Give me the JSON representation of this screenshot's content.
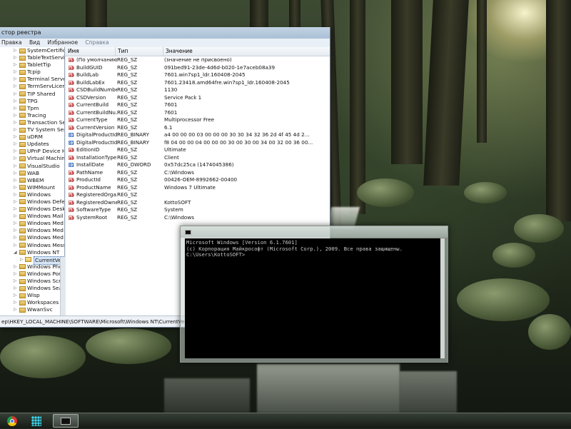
{
  "regedit": {
    "title": "стор реестра",
    "menu": [
      "Правка",
      "Вид",
      "Избранное",
      "Справка"
    ],
    "tree": [
      {
        "label": "SystemCertific",
        "exp": "▷"
      },
      {
        "label": "TableTextServi",
        "exp": "▷"
      },
      {
        "label": "TabletTip",
        "exp": "▷"
      },
      {
        "label": "Tcpip",
        "exp": "▷"
      },
      {
        "label": "Terminal Serve",
        "exp": "▷"
      },
      {
        "label": "TermServLicer",
        "exp": "▷"
      },
      {
        "label": "TIP Shared",
        "exp": "▷"
      },
      {
        "label": "TPG",
        "exp": "▷"
      },
      {
        "label": "Tpm",
        "exp": "▷"
      },
      {
        "label": "Tracing",
        "exp": "▷"
      },
      {
        "label": "Transaction Se",
        "exp": "▷"
      },
      {
        "label": "TV System Ser",
        "exp": "▷"
      },
      {
        "label": "uDRM",
        "exp": "▷"
      },
      {
        "label": "Updates",
        "exp": "▷"
      },
      {
        "label": "UPnP Device H",
        "exp": "▷"
      },
      {
        "label": "Virtual Machin",
        "exp": "▷"
      },
      {
        "label": "VisualStudio",
        "exp": "▷"
      },
      {
        "label": "WAB",
        "exp": "▷"
      },
      {
        "label": "WBEM",
        "exp": "▷"
      },
      {
        "label": "WIMMount",
        "exp": "▷"
      },
      {
        "label": "Windows",
        "exp": "▷"
      },
      {
        "label": "Windows Defe",
        "exp": "▷"
      },
      {
        "label": "Windows Desk",
        "exp": "▷"
      },
      {
        "label": "Windows Mail",
        "exp": "▷"
      },
      {
        "label": "Windows Med",
        "exp": "▷"
      },
      {
        "label": "Windows Med",
        "exp": "▷"
      },
      {
        "label": "Windows Med",
        "exp": "▷"
      },
      {
        "label": "Windows Mess",
        "exp": "▷"
      },
      {
        "label": "Windows NT",
        "exp": "◢"
      },
      {
        "label": "CurrentVer",
        "exp": "▷",
        "child": true,
        "selected": true
      },
      {
        "label": "Windows Phot",
        "exp": "▷"
      },
      {
        "label": "Windows Porta",
        "exp": "▷"
      },
      {
        "label": "Windows Scrip",
        "exp": "▷"
      },
      {
        "label": "Windows Sear",
        "exp": "▷"
      },
      {
        "label": "Wisp",
        "exp": "▷"
      },
      {
        "label": "Workspaces",
        "exp": "▷"
      },
      {
        "label": "WwanSvc",
        "exp": "▷"
      }
    ],
    "columns": [
      "Имя",
      "Тип",
      "Значение"
    ],
    "values": [
      {
        "icon": "ab",
        "name": "(По умолчанию)",
        "type": "REG_SZ",
        "data": "(значение не присвоено)"
      },
      {
        "icon": "ab",
        "name": "BuildGUID",
        "type": "REG_SZ",
        "data": "091bed91-23de-4d6d-b020-1e7aceb08a39"
      },
      {
        "icon": "ab",
        "name": "BuildLab",
        "type": "REG_SZ",
        "data": "7601.win7sp1_ldr.160408-2045"
      },
      {
        "icon": "ab",
        "name": "BuildLabEx",
        "type": "REG_SZ",
        "data": "7601.23418.amd64fre.win7sp1_ldr.160408-2045"
      },
      {
        "icon": "ab",
        "name": "CSDBuildNumber",
        "type": "REG_SZ",
        "data": "1130"
      },
      {
        "icon": "ab",
        "name": "CSDVersion",
        "type": "REG_SZ",
        "data": "Service Pack 1"
      },
      {
        "icon": "ab",
        "name": "CurrentBuild",
        "type": "REG_SZ",
        "data": "7601"
      },
      {
        "icon": "ab",
        "name": "CurrentBuildNu...",
        "type": "REG_SZ",
        "data": "7601"
      },
      {
        "icon": "ab",
        "name": "CurrentType",
        "type": "REG_SZ",
        "data": "Multiprocessor Free"
      },
      {
        "icon": "ab",
        "name": "CurrentVersion",
        "type": "REG_SZ",
        "data": "6.1"
      },
      {
        "icon": "bin",
        "name": "DigitalProductId",
        "type": "REG_BINARY",
        "data": "a4 00 00 00 03 00 00 00 30 30 34 32 36 2d 4f 45 4d 2..."
      },
      {
        "icon": "bin",
        "name": "DigitalProductId4",
        "type": "REG_BINARY",
        "data": "f8 04 00 00 04 00 00 00 30 00 30 00 34 00 32 00 36 00..."
      },
      {
        "icon": "ab",
        "name": "EditionID",
        "type": "REG_SZ",
        "data": "Ultimate"
      },
      {
        "icon": "ab",
        "name": "InstallationType",
        "type": "REG_SZ",
        "data": "Client"
      },
      {
        "icon": "bin",
        "name": "InstallDate",
        "type": "REG_DWORD",
        "data": "0x57dc25ca (1474045386)"
      },
      {
        "icon": "ab",
        "name": "PathName",
        "type": "REG_SZ",
        "data": "C:\\Windows"
      },
      {
        "icon": "ab",
        "name": "ProductId",
        "type": "REG_SZ",
        "data": "00426-OEM-8992662-00400"
      },
      {
        "icon": "ab",
        "name": "ProductName",
        "type": "REG_SZ",
        "data": "Windows 7 Ultimate"
      },
      {
        "icon": "ab",
        "name": "RegisteredOrga...",
        "type": "REG_SZ",
        "data": ""
      },
      {
        "icon": "ab",
        "name": "RegisteredOwner",
        "type": "REG_SZ",
        "data": "KottoSOFT"
      },
      {
        "icon": "ab",
        "name": "SoftwareType",
        "type": "REG_SZ",
        "data": "System"
      },
      {
        "icon": "ab",
        "name": "SystemRoot",
        "type": "REG_SZ",
        "data": "C:\\Windows"
      }
    ],
    "status_path": "ер\\HKEY_LOCAL_MACHINE\\SOFTWARE\\Microsoft\\Windows NT\\CurrentVersion"
  },
  "cmd": {
    "lines": [
      "Microsoft Windows [Version 6.1.7601]",
      "(c) Корпорация Майкрософт (Microsoft Corp.), 2009. Все права защищены.",
      "",
      "C:\\Users\\KottoSOFT>"
    ]
  },
  "taskbar": {
    "items": [
      "chrome-icon",
      "app-dots-icon",
      "cmd-icon"
    ]
  }
}
